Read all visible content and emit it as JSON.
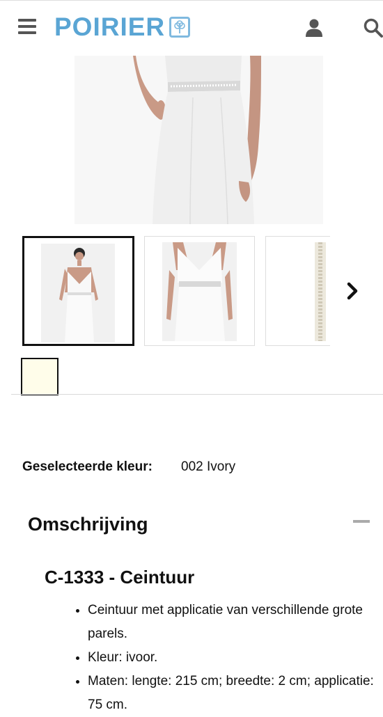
{
  "header": {
    "logo_text": "POIRIER",
    "menu_icon": "hamburger-menu-icon",
    "account_icon": "user-icon",
    "search_icon": "search-icon",
    "brand_color": "#5aa5d4"
  },
  "gallery": {
    "next_icon": "chevron-right-icon"
  },
  "swatch": {
    "color": "#fffdea"
  },
  "selected_color": {
    "label": "Geselecteerde kleur:",
    "value": "002 Ivory"
  },
  "description": {
    "heading": "Omschrijving",
    "product_title": "C-1333 - Ceintuur",
    "features": [
      "Ceintuur met applicatie van verschillende grote parels.",
      "Kleur: ivoor.",
      "Maten: lengte: 215 cm; breedte: 2 cm; applicatie: 75 cm."
    ]
  }
}
